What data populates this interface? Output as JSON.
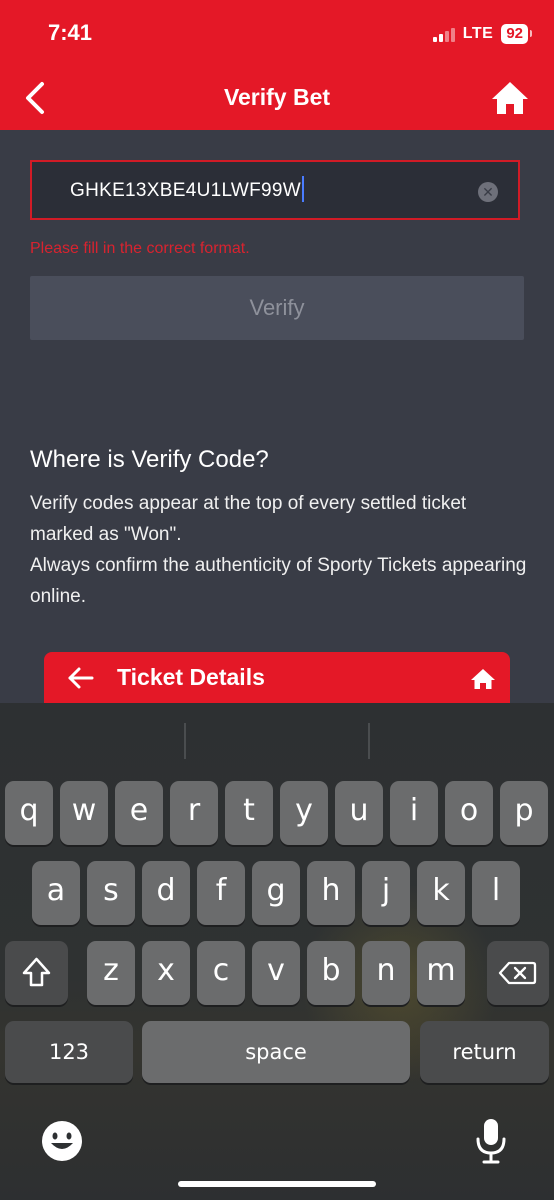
{
  "status_bar": {
    "time": "7:41",
    "network": "LTE",
    "battery": "92"
  },
  "nav": {
    "title": "Verify Bet",
    "back_icon": "chevron-left-icon",
    "home_icon": "home-icon"
  },
  "form": {
    "code_value": "GHKE13XBE4U1LWF99W",
    "error": "Please fill in the correct format.",
    "verify_label": "Verify"
  },
  "help": {
    "title": "Where is Verify Code?",
    "lines": [
      "Verify codes appear at the top of every settled ticket marked as \"Won\".",
      "Always confirm the authenticity of Sporty Tickets appearing online."
    ]
  },
  "ticket_preview": {
    "title": "Ticket Details"
  },
  "keyboard": {
    "row1": [
      "q",
      "w",
      "e",
      "r",
      "t",
      "y",
      "u",
      "i",
      "o",
      "p"
    ],
    "row2": [
      "a",
      "s",
      "d",
      "f",
      "g",
      "h",
      "j",
      "k",
      "l"
    ],
    "row3": [
      "z",
      "x",
      "c",
      "v",
      "b",
      "n",
      "m"
    ],
    "numbers_label": "123",
    "space_label": "space",
    "return_label": "return"
  },
  "colors": {
    "brand_red": "#e41827",
    "background": "#393c46",
    "error": "#d8232f"
  }
}
